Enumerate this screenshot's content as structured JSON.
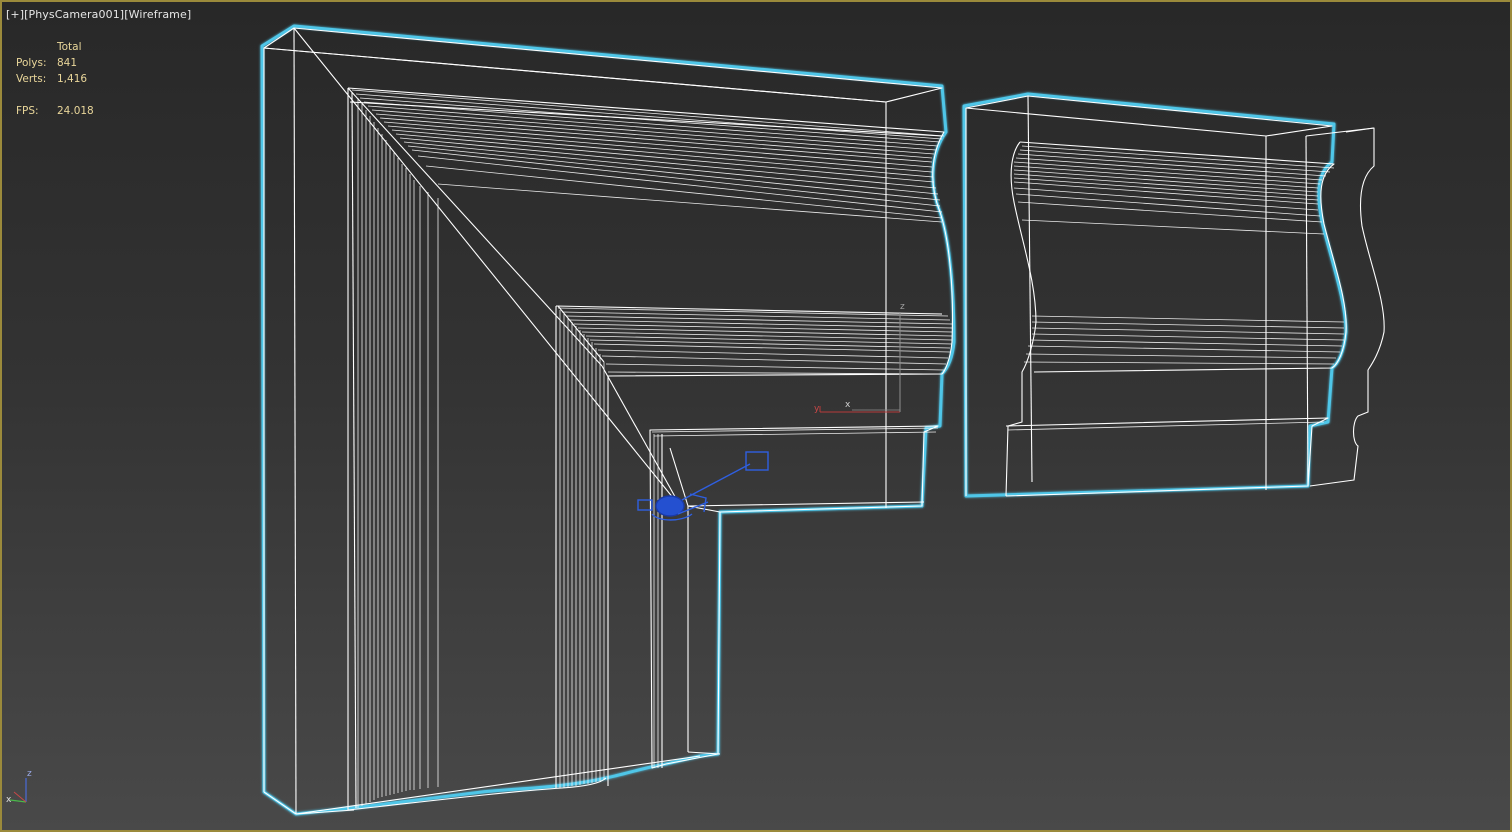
{
  "viewport": {
    "label_plus": "[+]",
    "label_camera": "[PhysCamera001]",
    "label_mode": "[Wireframe]",
    "border_color": "#9b8a3b",
    "selection_outline_color": "#4fc6e8"
  },
  "stats": {
    "header": "Total",
    "polys_label": "Polys:",
    "polys_value": "841",
    "verts_label": "Verts:",
    "verts_value": "1,416",
    "fps_label": "FPS:",
    "fps_value": "24.018"
  },
  "gizmo": {
    "x_label": "x",
    "y_label": "y",
    "z_label": "z"
  },
  "axis_tripod": {
    "x_label": "x",
    "z_label": "z"
  }
}
